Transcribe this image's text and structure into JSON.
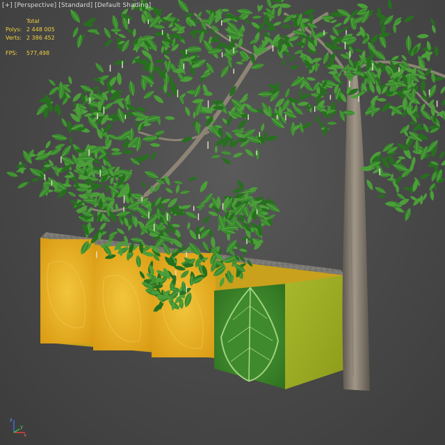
{
  "viewport": {
    "menu": {
      "plus": "[+]",
      "view": "[Perspective]",
      "style": "[Standard]",
      "shading": "[Default Shading]"
    },
    "stats": {
      "header": "Total",
      "polys_label": "Polys:",
      "polys_value": "2 448 005",
      "verts_label": "Verts:",
      "verts_value": "2 386 452",
      "fps_label": "FPS:",
      "fps_value": "577,498"
    },
    "gizmo": {
      "icon": "xyz-axis-gizmo-icon",
      "x": "x",
      "y": "y",
      "z": "z"
    },
    "colors": {
      "stats_text": "#f0d040",
      "menu_text": "#dcdcdc",
      "background": "#4a4a4a"
    }
  }
}
